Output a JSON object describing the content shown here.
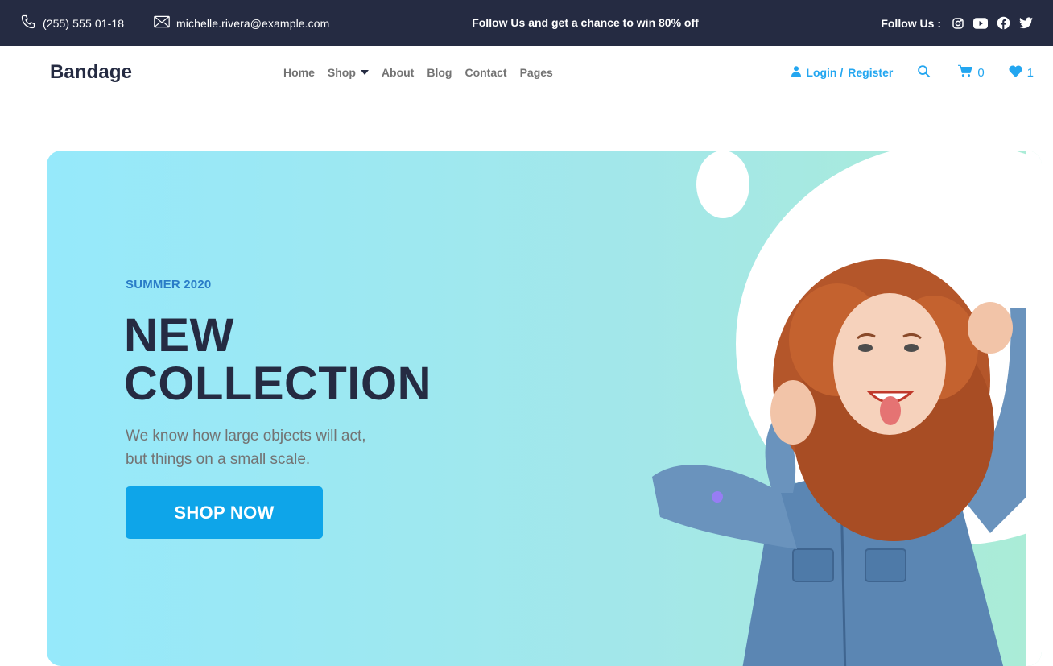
{
  "topbar": {
    "phone": "(255) 555 01-18",
    "email": "michelle.rivera@example.com",
    "promo": "Follow Us  and get a chance to win 80% off",
    "follow_label": "Follow Us :",
    "social_icons": [
      "instagram-icon",
      "youtube-icon",
      "facebook-icon",
      "twitter-icon"
    ]
  },
  "navbar": {
    "brand": "Bandage",
    "menu": {
      "home": "Home",
      "shop": "Shop",
      "about": "About",
      "blog": "Blog",
      "contact": "Contact",
      "pages": "Pages"
    },
    "login": "Login /",
    "register": "Register",
    "cart_count": "0",
    "wishlist_count": "1"
  },
  "hero": {
    "kicker": "SUMMER 2020",
    "title_line1": "NEW",
    "title_line2": "COLLECTION",
    "desc_line1": "We know how large objects will act,",
    "desc_line2": "but things on a small scale.",
    "cta": "SHOP NOW"
  },
  "colors": {
    "topbar_bg": "#252b42",
    "accent": "#23a6f0",
    "cta": "#0ea5e9",
    "heading": "#252b42",
    "muted": "#737373"
  }
}
